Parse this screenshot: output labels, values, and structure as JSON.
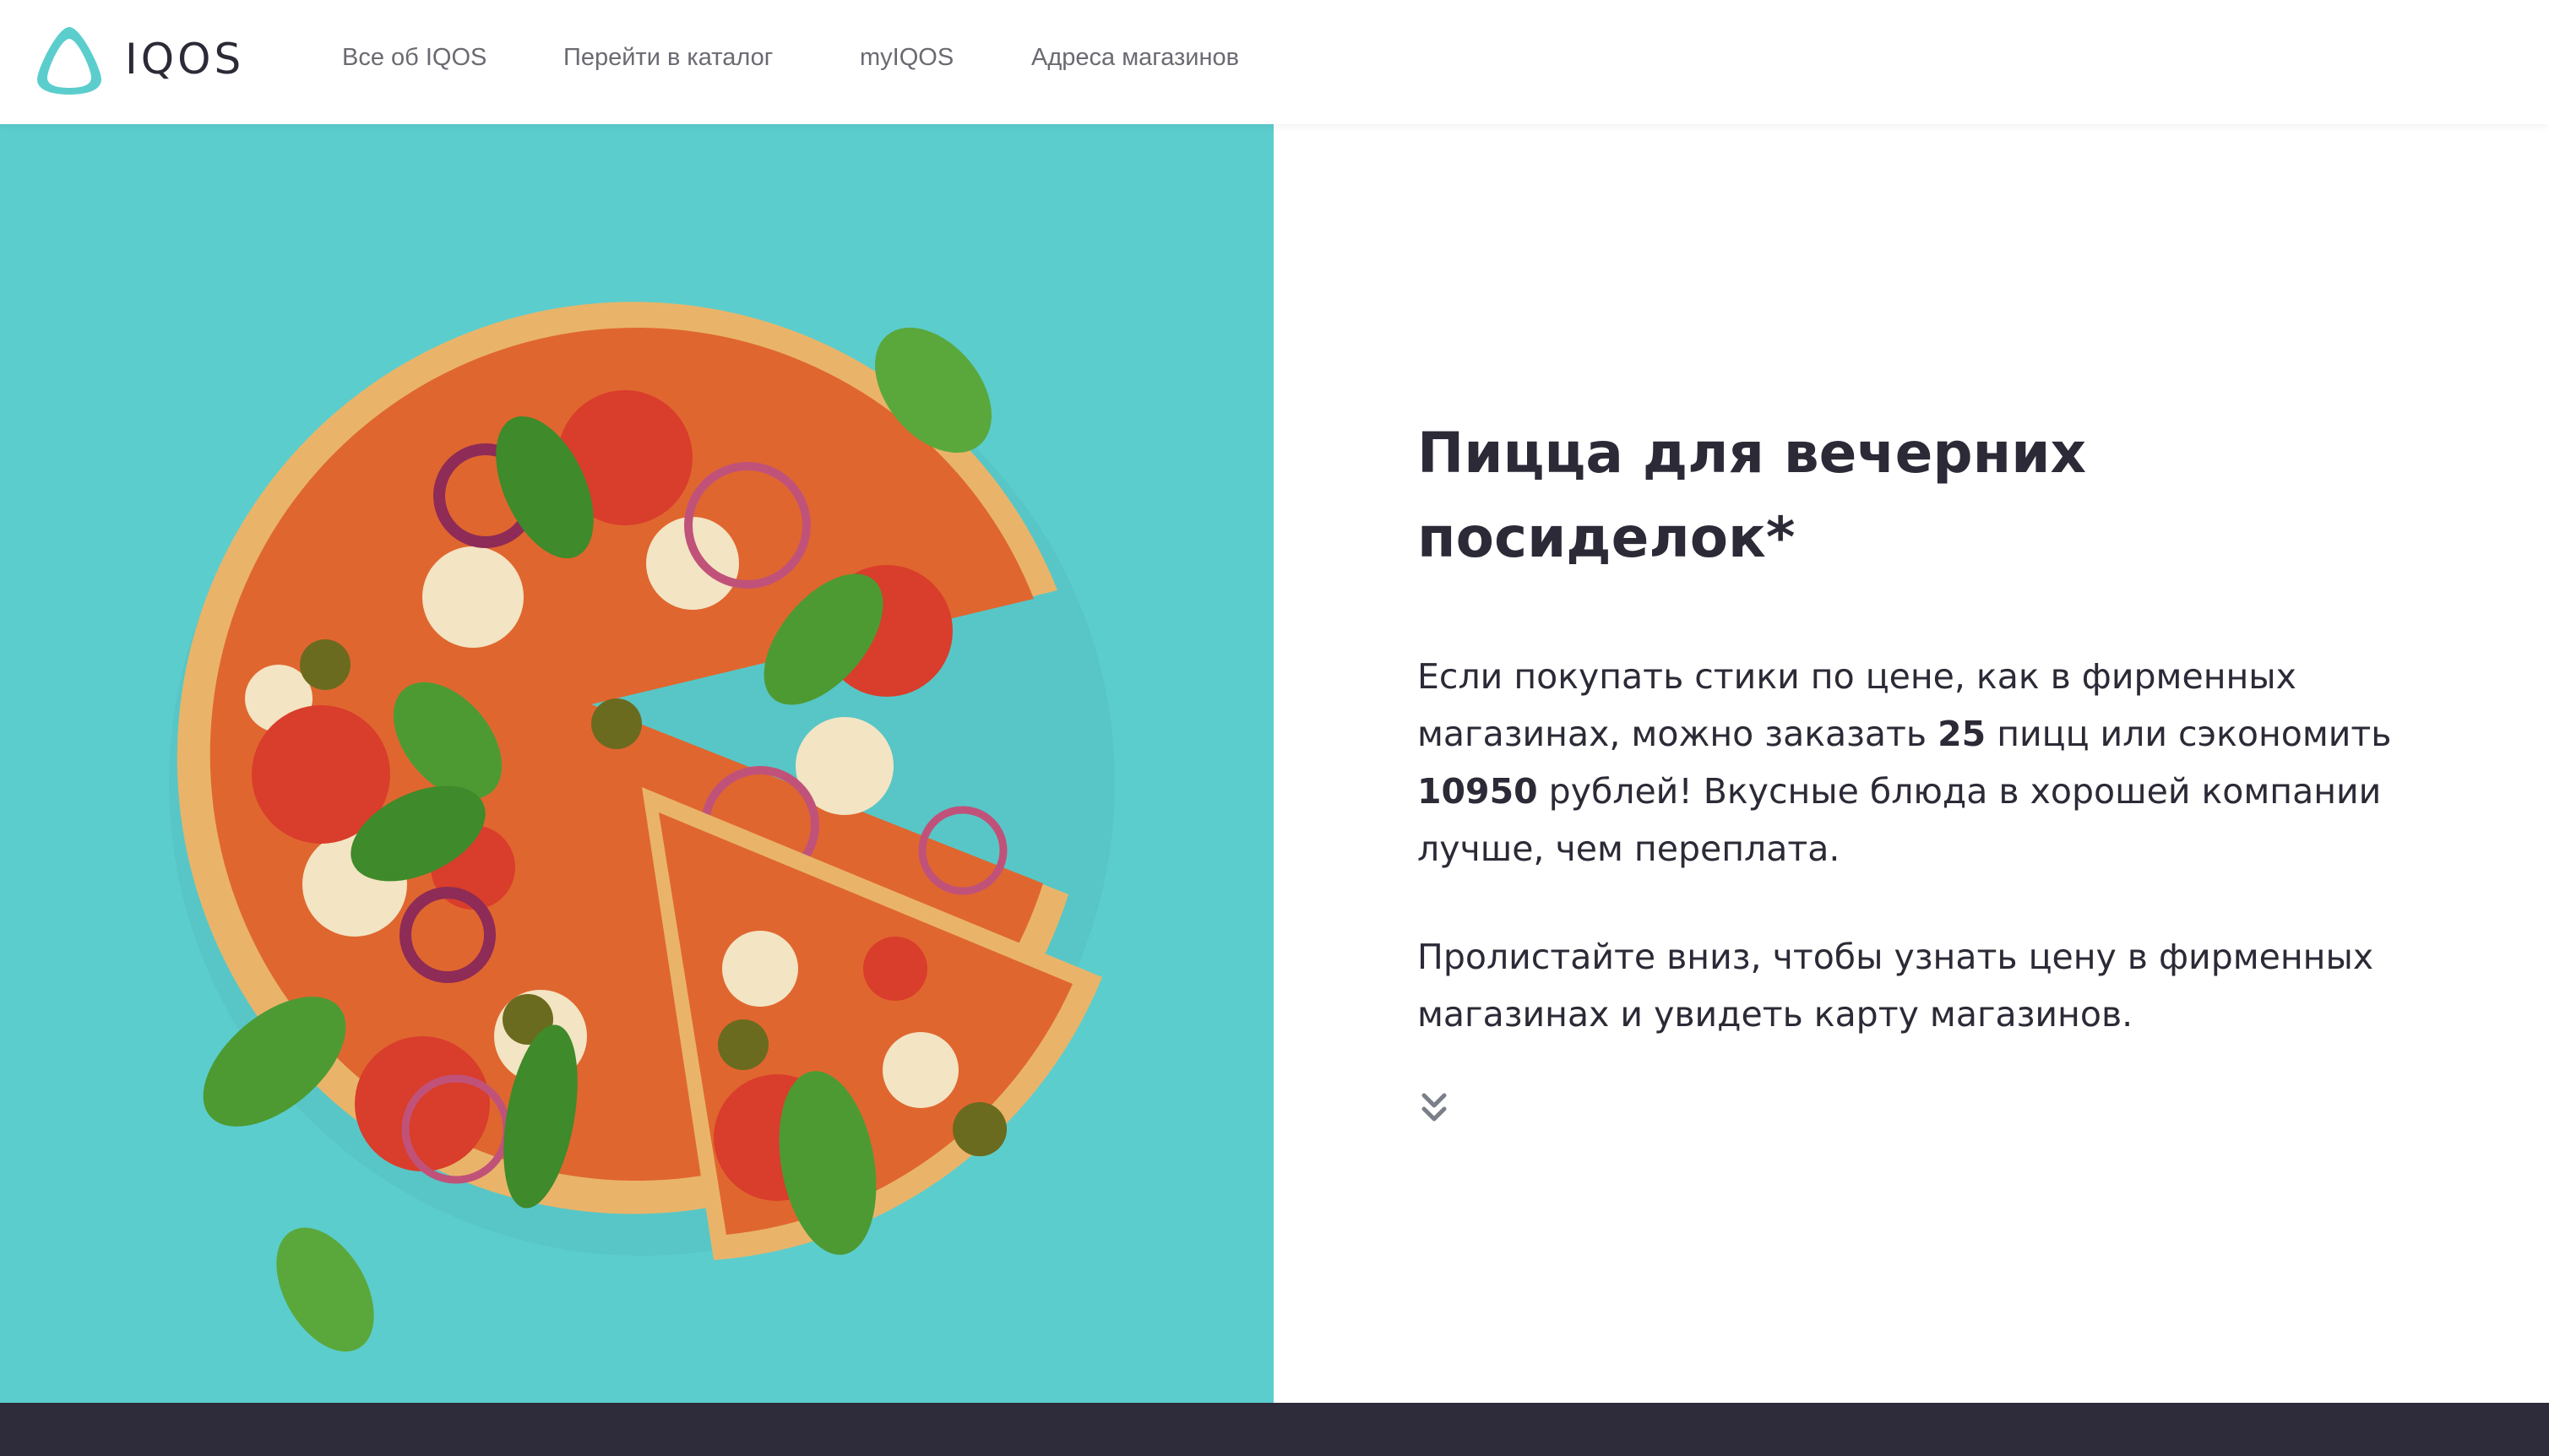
{
  "header": {
    "logo_text": "IQOS",
    "nav": [
      {
        "label": "Все об IQOS"
      },
      {
        "label": "Перейти в каталог"
      },
      {
        "label": "myIQOS"
      },
      {
        "label": "Адреса магазинов"
      }
    ]
  },
  "hero": {
    "image": "pizza-photo",
    "title_line1": "Пицца для вечерних",
    "title_line2": "посиделок*",
    "paragraph1": {
      "part1": "Если покупать стики по цене, как в фирменных магазинах, можно заказать ",
      "count": "25",
      "part2": " пицц или сэкономить ",
      "amount": "10950",
      "part3": " рублей! Вкусные блюда в хорошей компании лучше, чем переплата."
    },
    "paragraph2": "Пролистайте вниз, чтобы узнать цену в фирменных магазинах и увидеть карту магазинов.",
    "scroll_icon": "double-chevron-down-icon"
  },
  "colors": {
    "teal": "#5ccdcd",
    "dark": "#2e2c3a",
    "text": "#2b2a36",
    "nav_text": "#6b6a72"
  }
}
